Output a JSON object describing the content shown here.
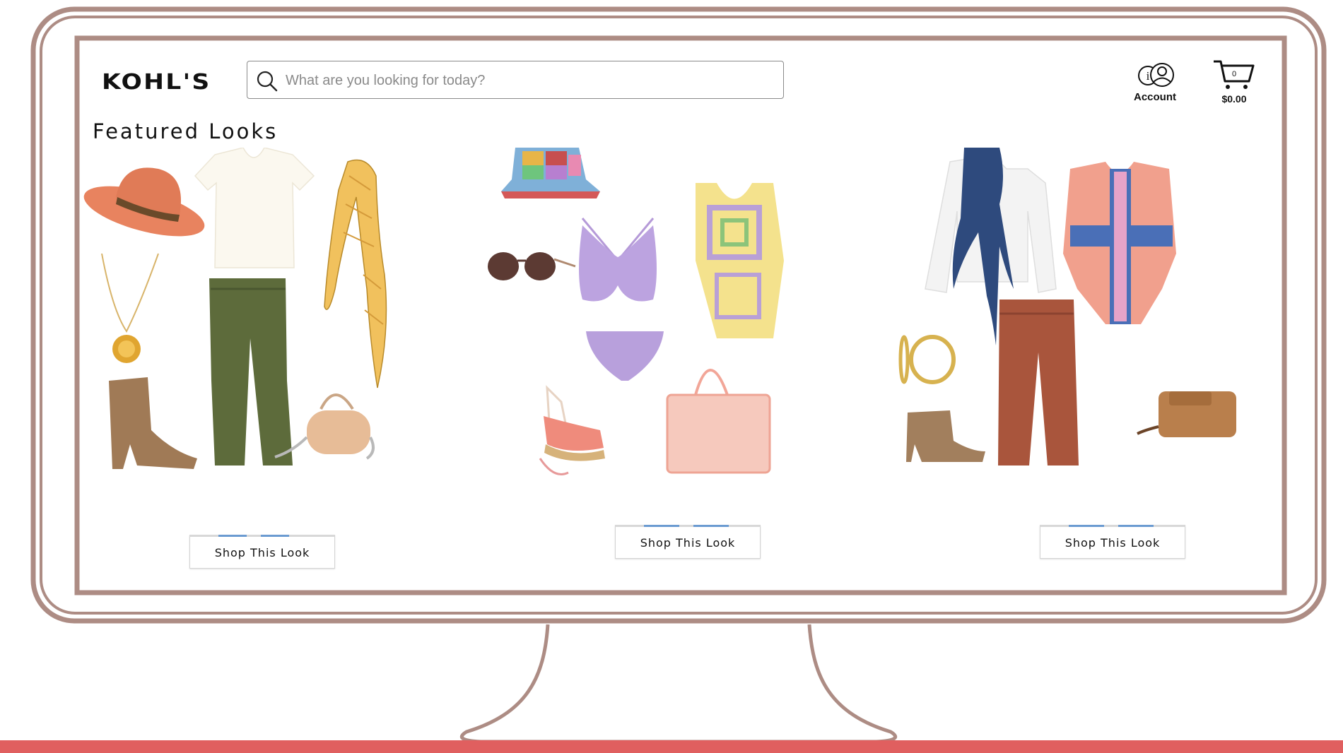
{
  "brand": {
    "logo_text": "KOHL'S"
  },
  "search": {
    "placeholder": "What are you looking for today?",
    "value": ""
  },
  "account": {
    "label": "Account",
    "icon": "account-info-icon"
  },
  "cart": {
    "count": "0",
    "total": "$0.00",
    "icon": "cart-icon"
  },
  "main": {
    "section_title": "Featured Looks",
    "looks": [
      {
        "button_label": "Shop This Look",
        "items": [
          "orange-fedora-hat",
          "white-v-neck-tee",
          "yellow-patterned-scarf",
          "gold-pendant-necklace",
          "olive-flare-jeans",
          "tan-cowboy-bootie",
          "beige-crossbody-bag"
        ]
      },
      {
        "button_label": "Shop This Look",
        "items": [
          "patchwork-bucket-hat",
          "brown-sunglasses",
          "lavender-bikini-top",
          "lavender-bikini-bottom",
          "crochet-cover-up",
          "lace-up-espadrilles",
          "pink-mesh-tote"
        ]
      },
      {
        "button_label": "Shop This Look",
        "items": [
          "white-button-shirt",
          "navy-scarf",
          "patterned-poncho",
          "gold-hoop-earrings",
          "rust-jacquard-pants",
          "tan-ankle-bootie",
          "tan-crossbody-bag"
        ]
      }
    ]
  },
  "colors": {
    "frame": "#ad8c84",
    "accent_strip": "#e05f5f",
    "button_accent": "#6b9bd1"
  }
}
